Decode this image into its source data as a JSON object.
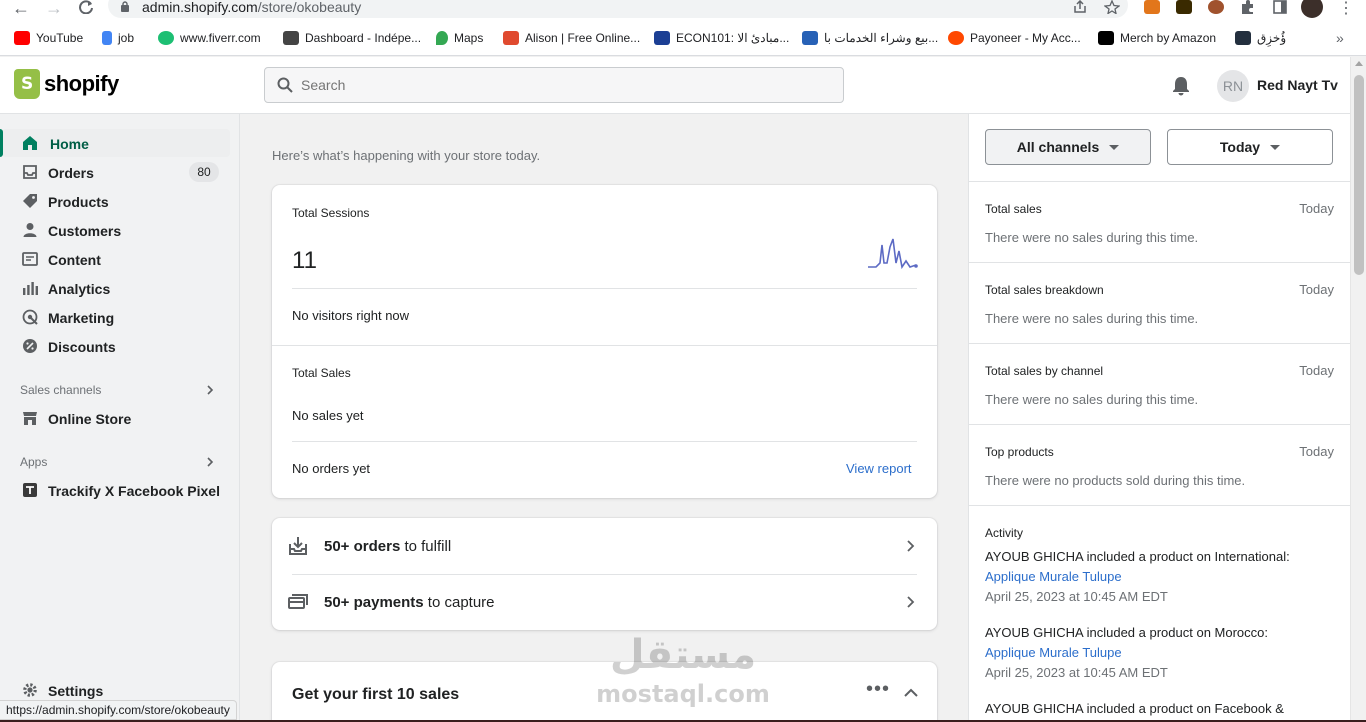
{
  "browser": {
    "url_host": "admin.shopify.com",
    "url_path": "/store/okobeauty",
    "bookmarks": [
      {
        "label": "YouTube",
        "icon": "youtube-icon",
        "color": "#ff0000"
      },
      {
        "label": "job",
        "icon": "job-icon",
        "color": "#4285f4"
      },
      {
        "label": "www.fiverr.com",
        "icon": "fiverr-icon",
        "color": "#1dbf73"
      },
      {
        "label": "Dashboard - Indépe...",
        "icon": "dashboard-icon",
        "color": "#444444"
      },
      {
        "label": "Maps",
        "icon": "maps-icon",
        "color": "#34a853"
      },
      {
        "label": "Alison | Free Online...",
        "icon": "alison-icon",
        "color": "#e04a2f"
      },
      {
        "label": "ECON101: مبادئ الا...",
        "icon": "econ-icon",
        "color": "#1c3f94"
      },
      {
        "label": "بيع وشراء الخدمات با...",
        "icon": "khamsat-icon",
        "color": "#2761b6"
      },
      {
        "label": "Payoneer - My Acc...",
        "icon": "payoneer-icon",
        "color": "#ff4800"
      },
      {
        "label": "Merch by Amazon",
        "icon": "amazon-icon",
        "color": "#000000"
      },
      {
        "label": "ؤُخزِق",
        "icon": "amazon-icon",
        "color": "#232f3e"
      }
    ],
    "status_url": "https://admin.shopify.com/store/okobeauty"
  },
  "topbar": {
    "logo_text": "shopify",
    "search_placeholder": "Search",
    "user_initials": "RN",
    "user_name": "Red Nayt Tv"
  },
  "sidebar": {
    "items": [
      {
        "label": "Home",
        "icon": "home-icon",
        "active": true
      },
      {
        "label": "Orders",
        "icon": "orders-icon",
        "badge": "80"
      },
      {
        "label": "Products",
        "icon": "tag-icon"
      },
      {
        "label": "Customers",
        "icon": "person-icon"
      },
      {
        "label": "Content",
        "icon": "content-icon"
      },
      {
        "label": "Analytics",
        "icon": "analytics-icon"
      },
      {
        "label": "Marketing",
        "icon": "marketing-icon"
      },
      {
        "label": "Discounts",
        "icon": "discount-icon"
      }
    ],
    "sales_channels_label": "Sales channels",
    "online_store_label": "Online Store",
    "apps_label": "Apps",
    "app_item_label": "Trackify X Facebook Pixel",
    "settings_label": "Settings"
  },
  "main": {
    "greeting": "Here’s what’s happening with your store today.",
    "sessions_label": "Total Sessions",
    "sessions_value": "11",
    "visitors_text": "No visitors right now",
    "sales_label": "Total Sales",
    "no_sales_text": "No sales yet",
    "no_orders_text": "No orders yet",
    "view_report": "View report",
    "tasks": [
      {
        "bold": "50+ orders",
        "rest": " to fulfill",
        "icon": "inbox-download-icon"
      },
      {
        "bold": "50+ payments",
        "rest": " to capture",
        "icon": "payment-card-icon"
      }
    ],
    "first_sales_title": "Get your first 10 sales"
  },
  "right_panel": {
    "channels_filter": "All channels",
    "date_filter": "Today",
    "sections": [
      {
        "title": "Total sales",
        "when": "Today",
        "message": "There were no sales during this time."
      },
      {
        "title": "Total sales breakdown",
        "when": "Today",
        "message": "There were no sales during this time."
      },
      {
        "title": "Total sales by channel",
        "when": "Today",
        "message": "There were no sales during this time."
      },
      {
        "title": "Top products",
        "when": "Today",
        "message": "There were no products sold during this time."
      }
    ],
    "activity_title": "Activity",
    "activity": [
      {
        "text": "AYOUB GHICHA included a product on International:",
        "link": "Applique Murale Tulupe",
        "time": "April 25, 2023 at 10:45 AM EDT"
      },
      {
        "text": "AYOUB GHICHA included a product on Morocco:",
        "link": "Applique Murale Tulupe",
        "time": "April 25, 2023 at 10:45 AM EDT"
      },
      {
        "text": "AYOUB GHICHA included a product on Facebook &",
        "link": "",
        "time": ""
      }
    ]
  },
  "watermark": {
    "arabic": "مستقل",
    "latin": "mostaql.com"
  },
  "colors": {
    "accent": "#008060",
    "link": "#2c6ecb",
    "shopify_green": "#95bf47"
  }
}
